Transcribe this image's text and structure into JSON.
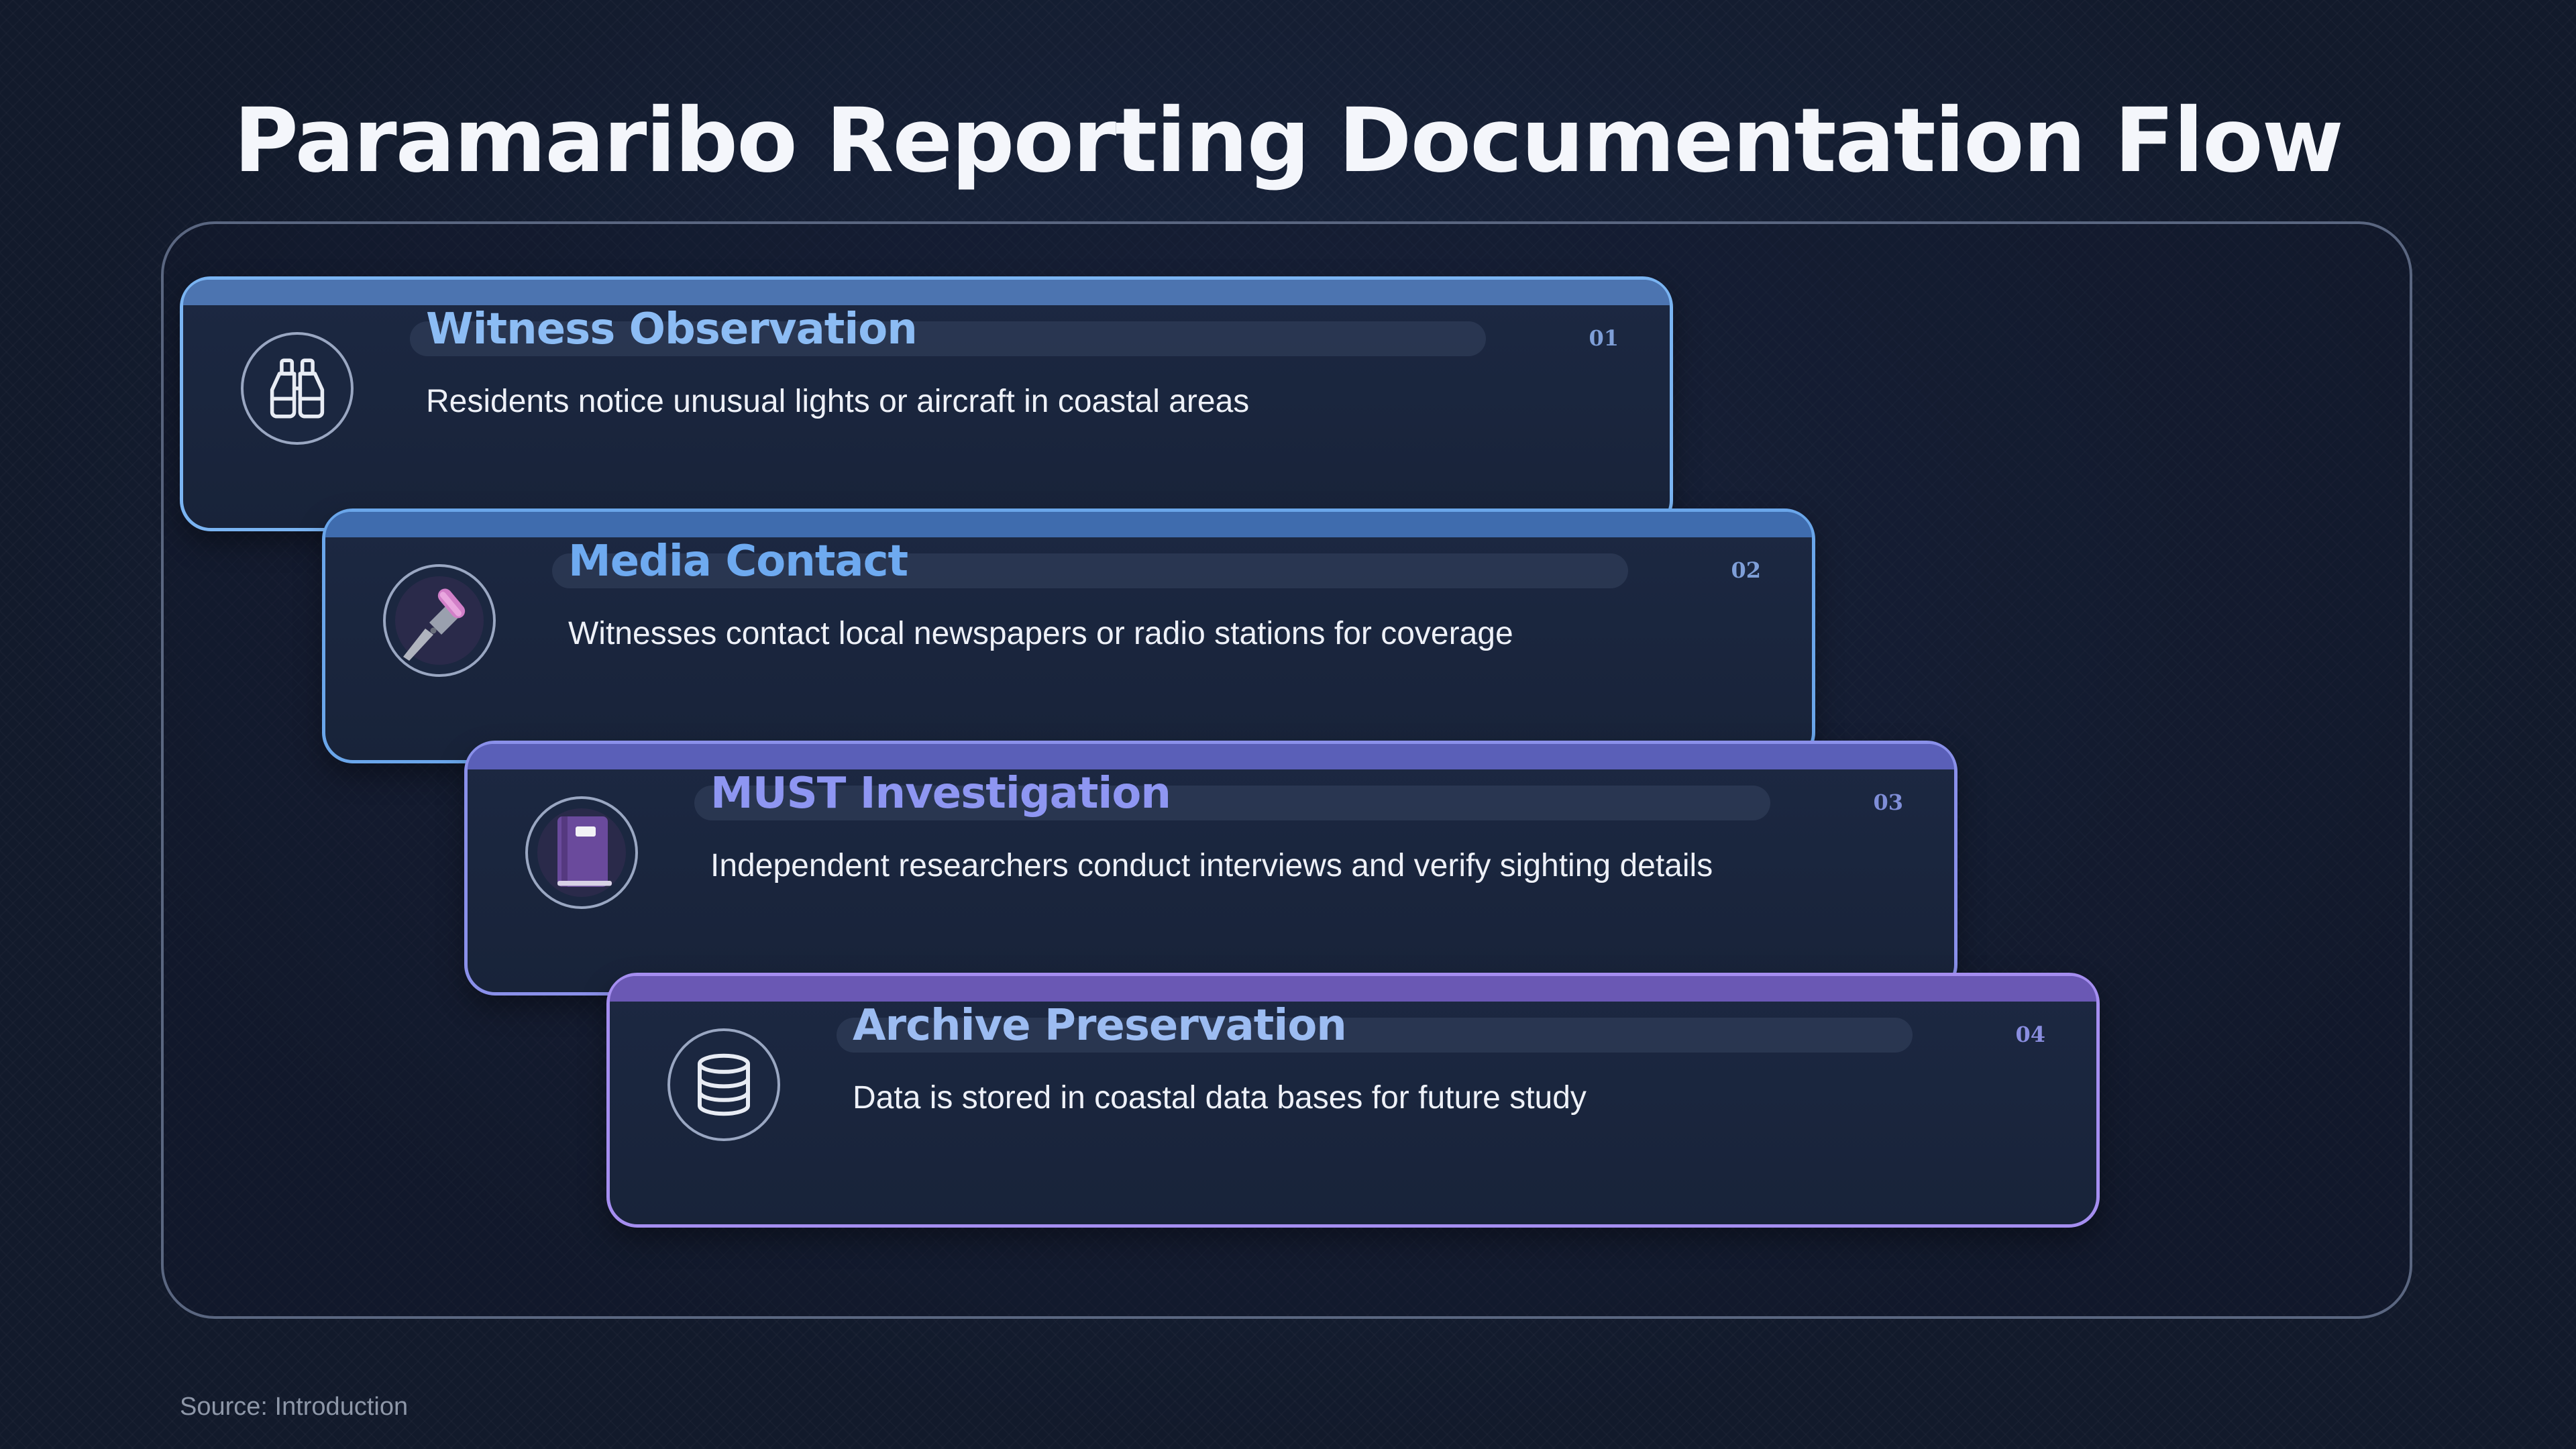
{
  "title": "Paramaribo Reporting Documentation Flow",
  "steps": [
    {
      "number": "01",
      "title": "Witness Observation",
      "description": "Residents notice unusual lights or aircraft in coastal areas",
      "icon": "binoculars-icon",
      "title_color": "#8cbcf4",
      "accent_color": "#7bb2f0"
    },
    {
      "number": "02",
      "title": "Media Contact",
      "description": "Witnesses contact local newspapers or radio stations for coverage",
      "icon": "microphone-icon",
      "title_color": "#6eaaf0",
      "accent_color": "#6aa6ea"
    },
    {
      "number": "03",
      "title": "MUST Investigation",
      "description": "Independent researchers conduct interviews and verify sighting details",
      "icon": "notebook-icon",
      "title_color": "#8e96f2",
      "accent_color": "#8a90ea"
    },
    {
      "number": "04",
      "title": "Archive Preservation",
      "description": "Data is stored in coastal data bases for future study",
      "icon": "database-icon",
      "title_color": "#9cbcf2",
      "accent_color": "#a58ef0"
    }
  ],
  "source": "Source: Introduction"
}
